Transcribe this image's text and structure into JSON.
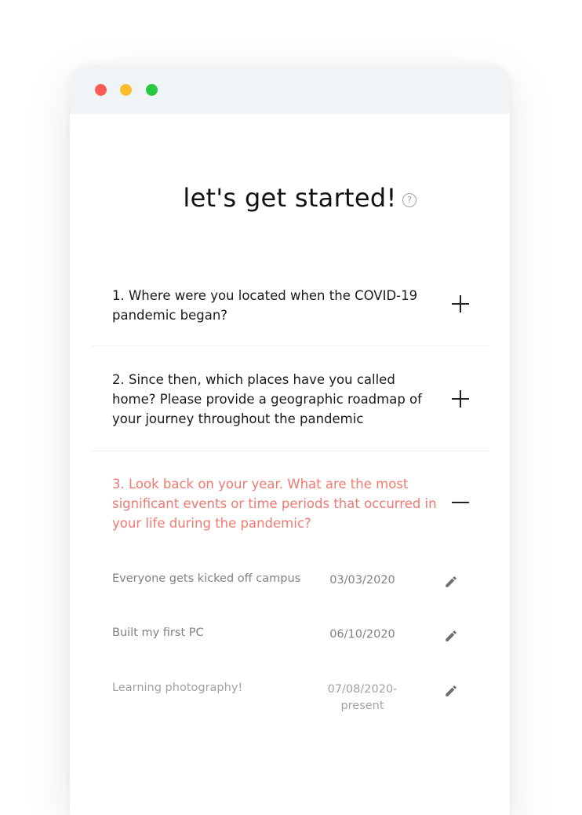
{
  "window": {
    "controls": [
      "close",
      "minimize",
      "maximize"
    ]
  },
  "page": {
    "title": "let's get started!",
    "help_icon": "?"
  },
  "questions": [
    {
      "label": "1. Where were you located when the COVID-19 pandemic began?",
      "state": "collapsed",
      "toggle_icon": "plus-icon"
    },
    {
      "label": "2. Since then, which places have you called home? Please provide a geographic roadmap of your journey throughout the pandemic",
      "state": "collapsed",
      "toggle_icon": "plus-icon"
    },
    {
      "label": "3. Look back on your year. What are the most significant events or time periods that occurred in your life during the pandemic?",
      "state": "expanded",
      "toggle_icon": "minus-icon"
    }
  ],
  "events": [
    {
      "title": "Everyone gets kicked off campus",
      "date": "03/03/2020",
      "action_icon": "pencil-icon"
    },
    {
      "title": "Built my first PC",
      "date": "06/10/2020",
      "action_icon": "pencil-icon"
    },
    {
      "title": "Learning photography!",
      "date": "07/08/2020-\npresent",
      "action_icon": "pencil-icon"
    }
  ],
  "colors": {
    "accent": "#f0796f",
    "text": "#1a1a1a",
    "muted": "#85807d",
    "titlebar": "#f1f4f7",
    "close": "#fc5b55",
    "minimize": "#fdbc2e",
    "maximize": "#27c93f"
  }
}
